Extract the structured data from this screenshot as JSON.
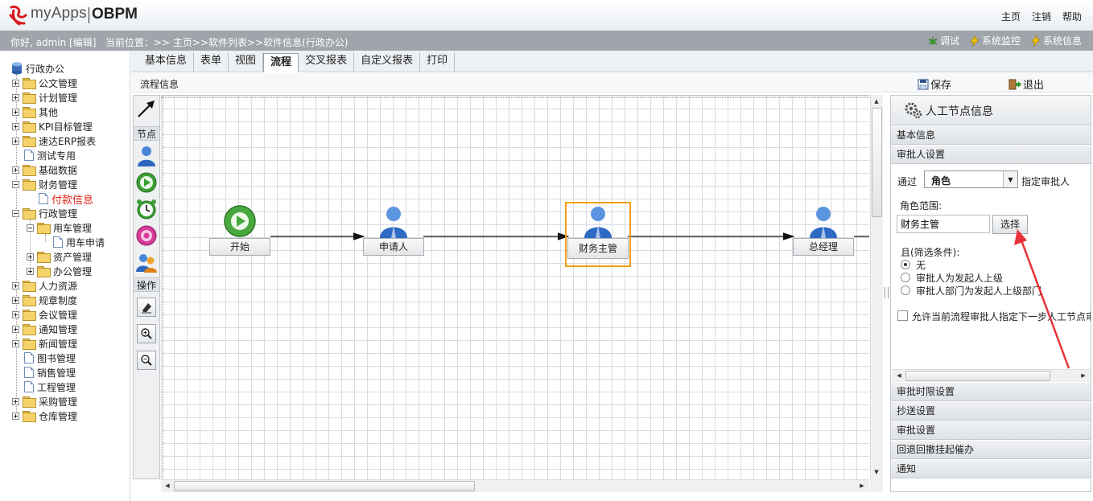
{
  "header": {
    "logo_text": "myApps",
    "brand": "OBPM",
    "links": [
      "主页",
      "注销",
      "帮助"
    ]
  },
  "subbar": {
    "greeting": "你好, admin [编辑]",
    "breadcrumb": "当前位置：>> 主页>>软件列表>>软件信息(行政办公)",
    "tools": [
      "调试",
      "系统监控",
      "系统信息"
    ]
  },
  "tree": {
    "root": "行政办公",
    "items": [
      "公文管理",
      "计划管理",
      "其他",
      "KPI目标管理",
      "速达ERP报表",
      "测试专用",
      "基础数据",
      "财务管理",
      "付款信息",
      "行政管理",
      "用车管理",
      "用车申请",
      "资产管理",
      "办公管理",
      "人力资源",
      "规章制度",
      "会议管理",
      "通知管理",
      "新闻管理",
      "图书管理",
      "销售管理",
      "工程管理",
      "采购管理",
      "仓库管理"
    ]
  },
  "tabs": [
    "基本信息",
    "表单",
    "视图",
    "流程",
    "交叉报表",
    "自定义报表",
    "打印"
  ],
  "active_tab": "流程",
  "flowbar": {
    "title": "流程信息",
    "save": "保存",
    "exit": "退出"
  },
  "palette": {
    "nodes_header": "节点",
    "ops_header": "操作"
  },
  "flow": {
    "nodes": [
      {
        "label": "开始",
        "type": "start"
      },
      {
        "label": "申请人",
        "type": "manual"
      },
      {
        "label": "财务主管",
        "type": "manual",
        "selected": true
      },
      {
        "label": "总经理",
        "type": "manual"
      }
    ]
  },
  "panel": {
    "title": "人工节点信息",
    "sections_top": [
      "基本信息",
      "审批人设置"
    ],
    "through_label": "通过",
    "role_select": "角色",
    "assign_label": "指定审批人",
    "role_range_label": "角色范围:",
    "role_value": "财务主管",
    "choose_button": "选择",
    "filter_label": "且(筛选条件):",
    "options": [
      "无",
      "审批人为发起人上级",
      "审批人部门为发起人上级部门"
    ],
    "allow_checkbox": "允许当前流程审批人指定下一步人工节点审批人",
    "sections_bottom": [
      "审批时限设置",
      "抄送设置",
      "审批设置",
      "回退回撤挂起催办",
      "通知"
    ]
  },
  "colors": {
    "header_bar": "#9fa5ab",
    "selected_node": "#f5a01a",
    "annotation_arrow": "#e8323a",
    "active_tree_item": "#e0241b"
  }
}
